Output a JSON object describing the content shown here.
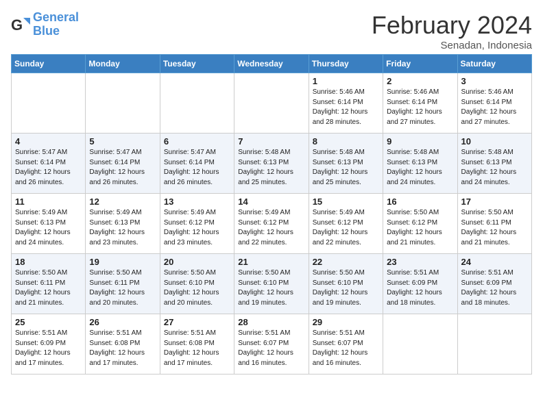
{
  "header": {
    "logo_general": "General",
    "logo_blue": "Blue",
    "month": "February 2024",
    "location": "Senadan, Indonesia"
  },
  "weekdays": [
    "Sunday",
    "Monday",
    "Tuesday",
    "Wednesday",
    "Thursday",
    "Friday",
    "Saturday"
  ],
  "weeks": [
    [
      {
        "day": "",
        "info": ""
      },
      {
        "day": "",
        "info": ""
      },
      {
        "day": "",
        "info": ""
      },
      {
        "day": "",
        "info": ""
      },
      {
        "day": "1",
        "info": "Sunrise: 5:46 AM\nSunset: 6:14 PM\nDaylight: 12 hours\nand 28 minutes."
      },
      {
        "day": "2",
        "info": "Sunrise: 5:46 AM\nSunset: 6:14 PM\nDaylight: 12 hours\nand 27 minutes."
      },
      {
        "day": "3",
        "info": "Sunrise: 5:46 AM\nSunset: 6:14 PM\nDaylight: 12 hours\nand 27 minutes."
      }
    ],
    [
      {
        "day": "4",
        "info": "Sunrise: 5:47 AM\nSunset: 6:14 PM\nDaylight: 12 hours\nand 26 minutes."
      },
      {
        "day": "5",
        "info": "Sunrise: 5:47 AM\nSunset: 6:14 PM\nDaylight: 12 hours\nand 26 minutes."
      },
      {
        "day": "6",
        "info": "Sunrise: 5:47 AM\nSunset: 6:14 PM\nDaylight: 12 hours\nand 26 minutes."
      },
      {
        "day": "7",
        "info": "Sunrise: 5:48 AM\nSunset: 6:13 PM\nDaylight: 12 hours\nand 25 minutes."
      },
      {
        "day": "8",
        "info": "Sunrise: 5:48 AM\nSunset: 6:13 PM\nDaylight: 12 hours\nand 25 minutes."
      },
      {
        "day": "9",
        "info": "Sunrise: 5:48 AM\nSunset: 6:13 PM\nDaylight: 12 hours\nand 24 minutes."
      },
      {
        "day": "10",
        "info": "Sunrise: 5:48 AM\nSunset: 6:13 PM\nDaylight: 12 hours\nand 24 minutes."
      }
    ],
    [
      {
        "day": "11",
        "info": "Sunrise: 5:49 AM\nSunset: 6:13 PM\nDaylight: 12 hours\nand 24 minutes."
      },
      {
        "day": "12",
        "info": "Sunrise: 5:49 AM\nSunset: 6:13 PM\nDaylight: 12 hours\nand 23 minutes."
      },
      {
        "day": "13",
        "info": "Sunrise: 5:49 AM\nSunset: 6:12 PM\nDaylight: 12 hours\nand 23 minutes."
      },
      {
        "day": "14",
        "info": "Sunrise: 5:49 AM\nSunset: 6:12 PM\nDaylight: 12 hours\nand 22 minutes."
      },
      {
        "day": "15",
        "info": "Sunrise: 5:49 AM\nSunset: 6:12 PM\nDaylight: 12 hours\nand 22 minutes."
      },
      {
        "day": "16",
        "info": "Sunrise: 5:50 AM\nSunset: 6:12 PM\nDaylight: 12 hours\nand 21 minutes."
      },
      {
        "day": "17",
        "info": "Sunrise: 5:50 AM\nSunset: 6:11 PM\nDaylight: 12 hours\nand 21 minutes."
      }
    ],
    [
      {
        "day": "18",
        "info": "Sunrise: 5:50 AM\nSunset: 6:11 PM\nDaylight: 12 hours\nand 21 minutes."
      },
      {
        "day": "19",
        "info": "Sunrise: 5:50 AM\nSunset: 6:11 PM\nDaylight: 12 hours\nand 20 minutes."
      },
      {
        "day": "20",
        "info": "Sunrise: 5:50 AM\nSunset: 6:10 PM\nDaylight: 12 hours\nand 20 minutes."
      },
      {
        "day": "21",
        "info": "Sunrise: 5:50 AM\nSunset: 6:10 PM\nDaylight: 12 hours\nand 19 minutes."
      },
      {
        "day": "22",
        "info": "Sunrise: 5:50 AM\nSunset: 6:10 PM\nDaylight: 12 hours\nand 19 minutes."
      },
      {
        "day": "23",
        "info": "Sunrise: 5:51 AM\nSunset: 6:09 PM\nDaylight: 12 hours\nand 18 minutes."
      },
      {
        "day": "24",
        "info": "Sunrise: 5:51 AM\nSunset: 6:09 PM\nDaylight: 12 hours\nand 18 minutes."
      }
    ],
    [
      {
        "day": "25",
        "info": "Sunrise: 5:51 AM\nSunset: 6:09 PM\nDaylight: 12 hours\nand 17 minutes."
      },
      {
        "day": "26",
        "info": "Sunrise: 5:51 AM\nSunset: 6:08 PM\nDaylight: 12 hours\nand 17 minutes."
      },
      {
        "day": "27",
        "info": "Sunrise: 5:51 AM\nSunset: 6:08 PM\nDaylight: 12 hours\nand 17 minutes."
      },
      {
        "day": "28",
        "info": "Sunrise: 5:51 AM\nSunset: 6:07 PM\nDaylight: 12 hours\nand 16 minutes."
      },
      {
        "day": "29",
        "info": "Sunrise: 5:51 AM\nSunset: 6:07 PM\nDaylight: 12 hours\nand 16 minutes."
      },
      {
        "day": "",
        "info": ""
      },
      {
        "day": "",
        "info": ""
      }
    ]
  ]
}
